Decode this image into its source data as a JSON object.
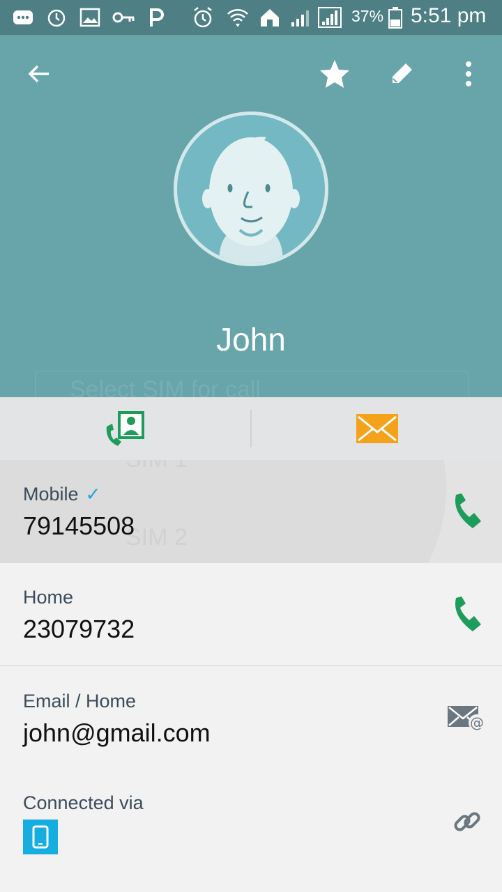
{
  "status_bar": {
    "battery": "37%",
    "time": "5:51 pm",
    "icons": [
      "message-icon",
      "alarm-icon",
      "gallery-icon",
      "key-icon",
      "p-icon",
      "alarm-clock-icon",
      "wifi-icon",
      "home-icon",
      "signal-icon",
      "signal-icon-2",
      "battery-icon"
    ]
  },
  "header": {
    "icons": [
      "back-arrow-icon",
      "star-icon",
      "edit-icon",
      "more-vertical-icon"
    ],
    "name": "John",
    "ghost_dialog": {
      "title": "Select SIM for call",
      "sim1": "SIM 1",
      "sim2": "SIM 2"
    }
  },
  "actions": {
    "icons": [
      "contact-call-icon",
      "message-icon"
    ],
    "colors": {
      "call": "#1e9c5c",
      "message": "#f5a21b"
    }
  },
  "details": {
    "mobile": {
      "label": "Mobile",
      "value": "79145508",
      "verified_icon": "check-icon"
    },
    "home": {
      "label": "Home",
      "value": "23079732"
    },
    "email": {
      "label": "Email / Home",
      "value": "john@gmail.com"
    },
    "connected": {
      "label": "Connected via",
      "device_icon": "tablet-icon"
    }
  },
  "colors": {
    "header": "#67a5aa",
    "status": "#4e7f84",
    "phone_icon": "#1e9c5c",
    "accent": "#1aa6e0"
  }
}
